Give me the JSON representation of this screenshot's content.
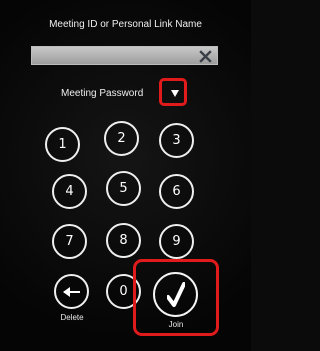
{
  "meeting_id": {
    "label": "Meeting ID or Personal Link Name",
    "value": "",
    "clear_icon": "close-icon"
  },
  "password": {
    "label": "Meeting Password",
    "toggle_icon": "chevron-down-icon"
  },
  "keypad": {
    "keys": [
      "1",
      "2",
      "3",
      "4",
      "5",
      "6",
      "7",
      "8",
      "9",
      "0"
    ],
    "delete_label": "Delete",
    "join_label": "Join",
    "delete_icon": "backspace-arrow-icon",
    "join_icon": "checkmark-icon"
  },
  "colors": {
    "highlight": "#e11b1b",
    "background": "#0b0b0b",
    "text": "#f2f2f2"
  }
}
